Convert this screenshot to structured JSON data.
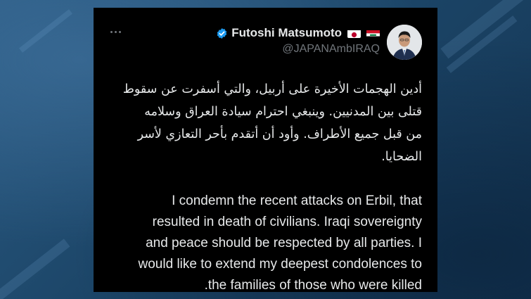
{
  "tweet": {
    "author": {
      "display_name": "Futoshi Matsumoto",
      "handle": "@JAPANAmbIRAQ",
      "verified": true,
      "flags": [
        "japan-flag",
        "iraq-flag"
      ]
    },
    "arabic_lines": [
      "أدين الهجمات الأخيرة على أربيل، والتي أسفرت عن سقوط",
      "قتلى بين المدنيين. وينبغي احترام سيادة العراق وسلامه",
      "من قبل جميع الأطراف.  وأود أن أتقدم بأحر التعازي لأسر",
      "الضحايا."
    ],
    "english_lines": [
      "I condemn the recent attacks on Erbil, that",
      "resulted in death of civilians. Iraqi sovereignty",
      "and peace should be respected by all parties. I",
      "would like to extend my deepest condolences to",
      ".the families of those who were killed"
    ]
  },
  "colors": {
    "card_background": "#000000",
    "primary_text": "#e7e9ea",
    "secondary_text": "#71767b",
    "verified_blue": "#1d9bf0",
    "page_background": "#1c4568"
  },
  "icons": {
    "more": "more-horizontal-icon",
    "verified": "verified-badge-icon"
  }
}
